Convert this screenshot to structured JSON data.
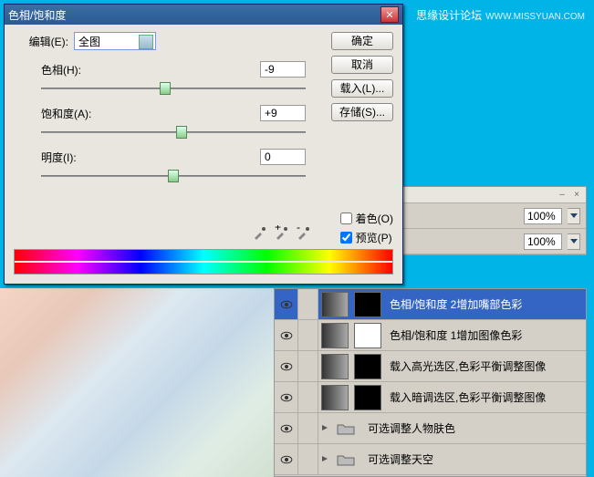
{
  "watermark": {
    "main": "思缘设计论坛",
    "sub": "WWW.MISSYUAN.COM"
  },
  "dialog": {
    "title": "色相/饱和度",
    "edit_label": "编辑(E):",
    "edit_value": "全图",
    "hue_label": "色相(H):",
    "hue_value": "-9",
    "sat_label": "饱和度(A):",
    "sat_value": "+9",
    "light_label": "明度(I):",
    "light_value": "0",
    "colorize_label": "着色(O)",
    "preview_label": "预览(P)",
    "buttons": {
      "ok": "确定",
      "cancel": "取消",
      "load": "载入(L)...",
      "save": "存储(S)..."
    }
  },
  "panel": {
    "opacity1": "100%",
    "opacity2": "100%"
  },
  "layers": [
    {
      "name": "色相/饱和度 2增加嘴部色彩",
      "selected": true,
      "type": "adj",
      "mask": "black"
    },
    {
      "name": "色相/饱和度 1增加图像色彩",
      "type": "adj",
      "mask": "white"
    },
    {
      "name": "载入高光选区,色彩平衡调整图像",
      "type": "adj2",
      "mask": "half"
    },
    {
      "name": "载入暗调选区,色彩平衡调整图像",
      "type": "adj2",
      "mask": "half2"
    },
    {
      "name": "可选调整人物肤色",
      "type": "folder"
    },
    {
      "name": "可选调整天空",
      "type": "folder"
    }
  ]
}
